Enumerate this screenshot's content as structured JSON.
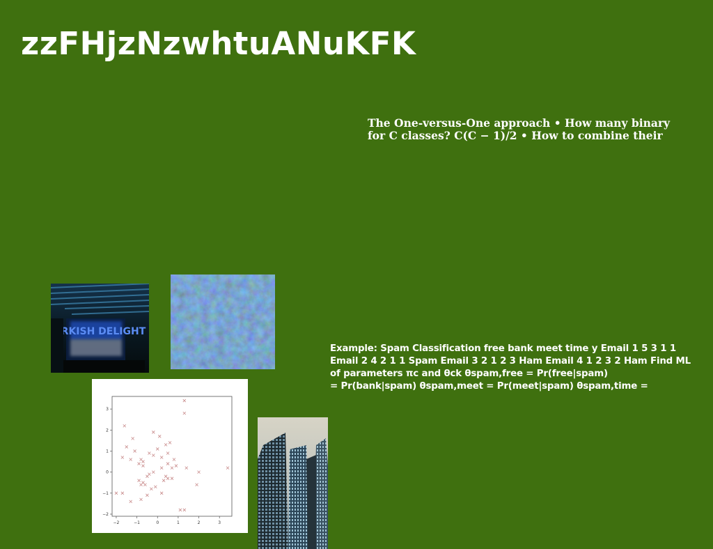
{
  "slide": {
    "title": "zzFHjzNzwhtuANuKFK",
    "text_block_1": {
      "lines": [
        "The One-versus-One approach • How many binary",
        "for C classes? C(C − 1)/2 • How to combine their"
      ]
    },
    "text_block_2": {
      "lines": [
        "Example: Spam Classification free bank meet time y Email 1 5 3 1 1",
        "Email 2 4 2 1 1 Spam Email 3 2 1 2 3 Ham Email 4 1 2 3 2 Ham Find ML",
        "of parameters πc and θck θspam,free = Pr(free|spam)",
        "= Pr(bank|spam) θspam,meet = Pr(meet|spam) θspam,time ="
      ]
    },
    "images": {
      "neon_sign": {
        "text": "TURKISH DELIGHT"
      },
      "texture": {},
      "scatter_plot": {
        "x_ticks": [
          "−2",
          "−1",
          "0",
          "1",
          "2",
          "3"
        ],
        "y_ticks": [
          "3",
          "2",
          "1",
          "0",
          "−1",
          "−2"
        ]
      },
      "skyscrapers": {}
    }
  },
  "colors": {
    "background": "#3f700f",
    "text": "#ffffff",
    "scatter_marker": "#c88a8a"
  },
  "chart_data": {
    "type": "scatter",
    "title": "",
    "xlabel": "",
    "ylabel": "",
    "xlim": [
      -2.2,
      3.6
    ],
    "ylim": [
      -2.1,
      3.6
    ],
    "marker": "x",
    "points": [
      [
        1.3,
        3.4
      ],
      [
        1.3,
        2.8
      ],
      [
        -1.6,
        2.2
      ],
      [
        -0.2,
        1.9
      ],
      [
        -1.2,
        1.6
      ],
      [
        0.1,
        1.7
      ],
      [
        0.6,
        1.4
      ],
      [
        0.4,
        1.3
      ],
      [
        -1.5,
        1.2
      ],
      [
        -1.1,
        1.0
      ],
      [
        0.0,
        1.1
      ],
      [
        -0.4,
        0.9
      ],
      [
        0.5,
        0.9
      ],
      [
        -0.2,
        0.8
      ],
      [
        -1.7,
        0.7
      ],
      [
        -0.8,
        0.6
      ],
      [
        0.2,
        0.7
      ],
      [
        -1.3,
        0.6
      ],
      [
        -0.7,
        0.5
      ],
      [
        0.8,
        0.6
      ],
      [
        -0.9,
        0.4
      ],
      [
        0.5,
        0.4
      ],
      [
        0.9,
        0.3
      ],
      [
        0.7,
        0.2
      ],
      [
        -0.7,
        0.3
      ],
      [
        0.2,
        0.2
      ],
      [
        1.4,
        0.2
      ],
      [
        3.4,
        0.2
      ],
      [
        -0.2,
        0.0
      ],
      [
        2.0,
        0.0
      ],
      [
        -0.4,
        -0.1
      ],
      [
        -0.5,
        -0.2
      ],
      [
        0.4,
        -0.2
      ],
      [
        0.5,
        -0.3
      ],
      [
        0.7,
        -0.3
      ],
      [
        -0.9,
        -0.4
      ],
      [
        -0.7,
        -0.5
      ],
      [
        0.3,
        -0.4
      ],
      [
        -0.8,
        -0.6
      ],
      [
        -0.6,
        -0.6
      ],
      [
        1.9,
        -0.6
      ],
      [
        -0.1,
        -0.7
      ],
      [
        -0.3,
        -0.8
      ],
      [
        -1.7,
        -1.0
      ],
      [
        -2.0,
        -1.0
      ],
      [
        -0.5,
        -1.1
      ],
      [
        0.2,
        -1.0
      ],
      [
        -1.3,
        -1.4
      ],
      [
        -0.8,
        -1.3
      ],
      [
        1.1,
        -1.8
      ],
      [
        1.3,
        -1.8
      ]
    ]
  }
}
